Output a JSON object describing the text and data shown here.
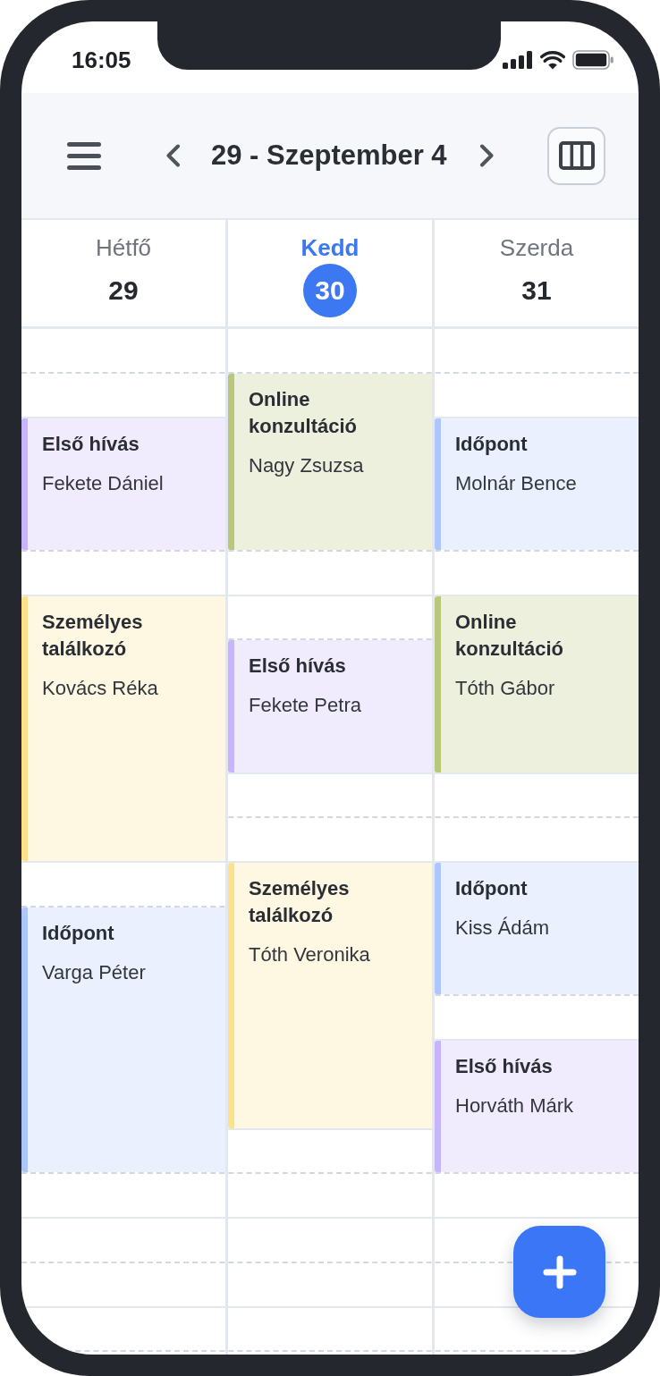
{
  "status_bar": {
    "time": "16:05"
  },
  "header": {
    "title": "29 - Szeptember 4"
  },
  "days": [
    {
      "name": "Hétfő",
      "date": "29",
      "selected": false,
      "events": [
        {
          "title": "Első hívás",
          "person": "Fekete Dániel",
          "color": "#c6b5fb"
        },
        {
          "title": "Személyes találkozó",
          "person": "Kovács Réka",
          "color": "#fde18d"
        },
        {
          "title": "Időpont",
          "person": "Varga Péter",
          "color": "#adc6fc"
        }
      ]
    },
    {
      "name": "Kedd",
      "date": "30",
      "selected": true,
      "events": [
        {
          "title": "Online konzultáció",
          "person": "Nagy Zsuzsa",
          "color": "#b9c77c"
        },
        {
          "title": "Első hívás",
          "person": "Fekete Petra",
          "color": "#c6b5fb"
        },
        {
          "title": "Személyes találkozó",
          "person": "Tóth Veronika",
          "color": "#fde18d"
        }
      ]
    },
    {
      "name": "Szerda",
      "date": "31",
      "selected": false,
      "events": [
        {
          "title": "Időpont",
          "person": "Molnár Bence",
          "color": "#adc6fc"
        },
        {
          "title": "Online konzultáció",
          "person": "Tóth Gábor",
          "color": "#b9c77c"
        },
        {
          "title": "Időpont",
          "person": "Kiss Ádám",
          "color": "#adc6fc"
        },
        {
          "title": "Első hívás",
          "person": "Horváth Márk",
          "color": "#c6b5fb"
        }
      ]
    }
  ]
}
